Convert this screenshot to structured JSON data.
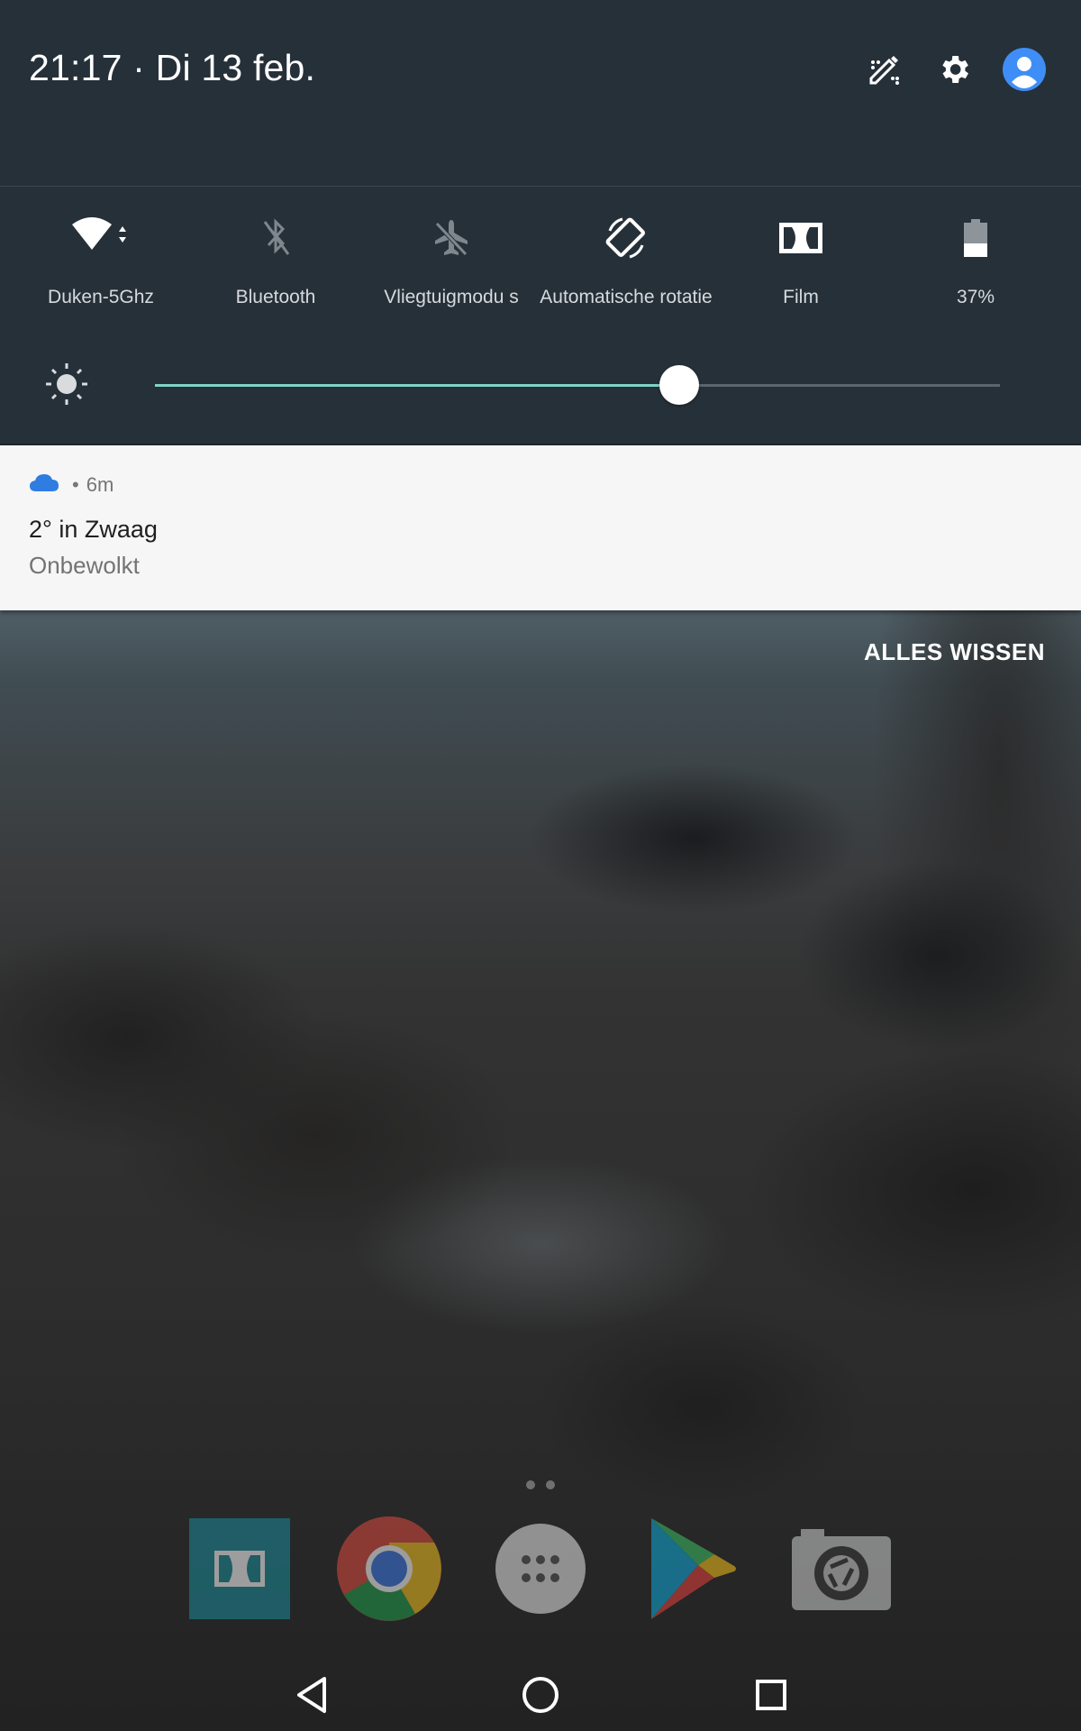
{
  "header": {
    "datetime": "21:17 · Di 13 feb."
  },
  "quick_settings": [
    {
      "label": "Duken-5Ghz",
      "icon": "wifi-icon",
      "state": "on"
    },
    {
      "label": "Bluetooth",
      "icon": "bluetooth-off-icon",
      "state": "off"
    },
    {
      "label": "Vliegtuigmodu s",
      "icon": "airplane-mode-off-icon",
      "state": "off"
    },
    {
      "label": "Automatische rotatie",
      "icon": "auto-rotate-icon",
      "state": "on"
    },
    {
      "label": "Film",
      "icon": "dolby-icon",
      "state": "on"
    },
    {
      "label": "37%",
      "icon": "battery-icon",
      "state": "on"
    }
  ],
  "brightness": {
    "icon": "brightness-icon",
    "level": 0.62
  },
  "notification": {
    "time": "6m",
    "title": "2° in Zwaag",
    "text": "Onbewolkt",
    "icon": "cloud-icon"
  },
  "clear_all_label": "ALLES WISSEN",
  "dock_apps": [
    {
      "name": "Dolby",
      "icon": "dolby-app-icon"
    },
    {
      "name": "Chrome",
      "icon": "chrome-app-icon"
    },
    {
      "name": "Apps",
      "icon": "app-drawer-icon"
    },
    {
      "name": "Play Store",
      "icon": "play-store-app-icon"
    },
    {
      "name": "Camera",
      "icon": "camera-app-icon"
    }
  ],
  "colors": {
    "shade_bg": "#263039",
    "slider_accent": "#7fd3c7",
    "card_bg": "#f6f6f6"
  }
}
